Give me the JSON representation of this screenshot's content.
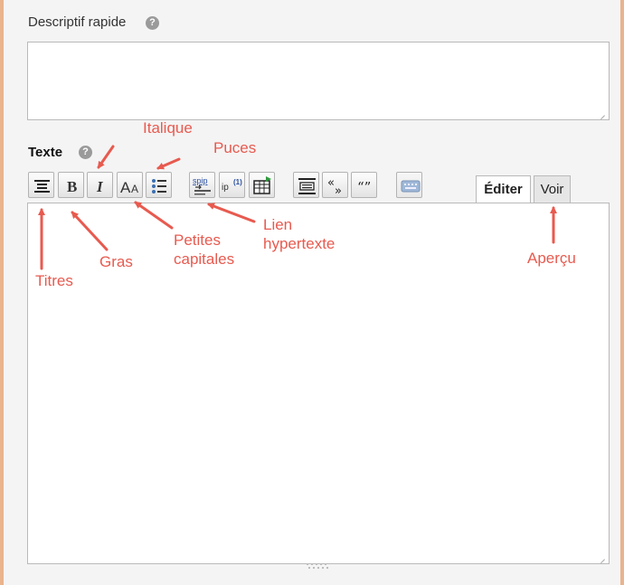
{
  "descriptif": {
    "label": "Descriptif rapide",
    "help": "?",
    "value": ""
  },
  "texte": {
    "label": "Texte",
    "help": "?",
    "value": ""
  },
  "toolbar": {
    "buttons": [
      {
        "name": "titres-button",
        "icon": "heading-icon"
      },
      {
        "name": "gras-button",
        "icon": "bold-icon",
        "glyph": "B"
      },
      {
        "name": "italique-button",
        "icon": "italic-icon",
        "glyph": "I"
      },
      {
        "name": "petites-capitales-button",
        "icon": "small-caps-icon",
        "glyph": "AA"
      },
      {
        "name": "puces-button",
        "icon": "bullet-list-icon"
      },
      {
        "name": "lien-button",
        "icon": "spip-link-icon",
        "glyph": "spip"
      },
      {
        "name": "note-button",
        "icon": "footnote-icon",
        "glyph": "ip(1)"
      },
      {
        "name": "table-button",
        "icon": "table-icon"
      },
      {
        "name": "encadre-button",
        "icon": "frame-icon"
      },
      {
        "name": "guillemets-button",
        "icon": "guillemets-icon",
        "glyph": "«»"
      },
      {
        "name": "citation-button",
        "icon": "quote-icon",
        "glyph": "“”"
      },
      {
        "name": "clavier-button",
        "icon": "keyboard-icon"
      }
    ]
  },
  "tabs": {
    "edit": "Éditer",
    "view": "Voir"
  },
  "annotations": {
    "italique": "Italique",
    "puces": "Puces",
    "titres": "Titres",
    "gras": "Gras",
    "petites_capitales": [
      "Petites",
      "capitales"
    ],
    "lien_hypertexte": [
      "Lien",
      "hypertexte"
    ],
    "apercu": "Aperçu"
  },
  "colors": {
    "annotation": "#e85a4f",
    "border_accent": "#e9b48e"
  }
}
